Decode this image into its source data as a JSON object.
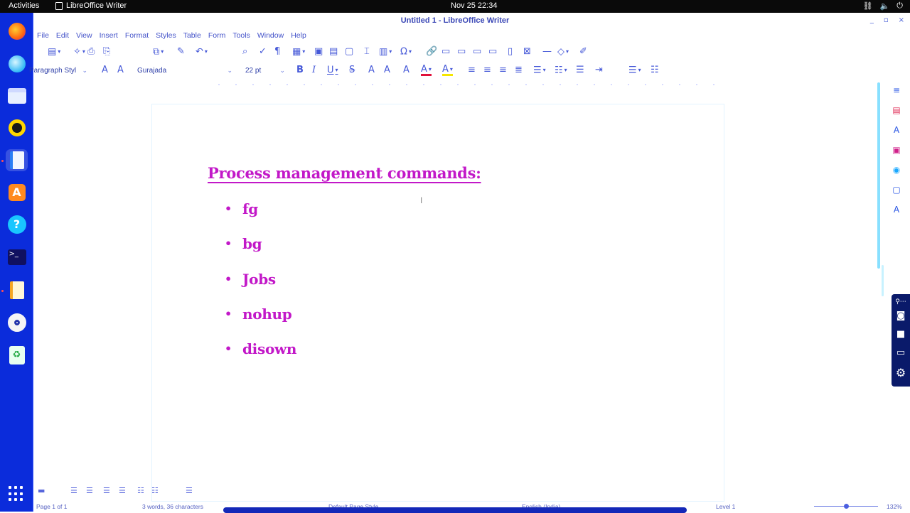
{
  "topbar": {
    "activities": "Activities",
    "app_name": "LibreOffice Writer",
    "clock": "Nov 25  22:34",
    "tray": [
      "network-icon",
      "volume-icon",
      "power-icon"
    ]
  },
  "window": {
    "title": "Untitled 1 - LibreOffice Writer",
    "controls": [
      "_",
      "▫",
      "×"
    ]
  },
  "menubar": [
    "File",
    "Edit",
    "View",
    "Insert",
    "Format",
    "Styles",
    "Table",
    "Form",
    "Tools",
    "Window",
    "Help"
  ],
  "formatting": {
    "paragraph_style": "Paragraph Styl",
    "font_name": "Gurajada",
    "font_size": "22 pt"
  },
  "document": {
    "heading": "Process management commands:",
    "bullet_glyph": "•",
    "items": [
      "fg",
      "bg",
      "Jobs",
      "nohup",
      "disown"
    ]
  },
  "statusbar": {
    "page": "Page 1 of 1",
    "word_count": "3 words, 36 characters",
    "page_style": "Default Page Style",
    "language": "English (India)",
    "outline_level": "Level 1",
    "zoom": "132%"
  },
  "colors": {
    "document_text": "#c218c8",
    "dock_background": "#0b2cdb",
    "topbar_background": "#0a0a0a"
  }
}
